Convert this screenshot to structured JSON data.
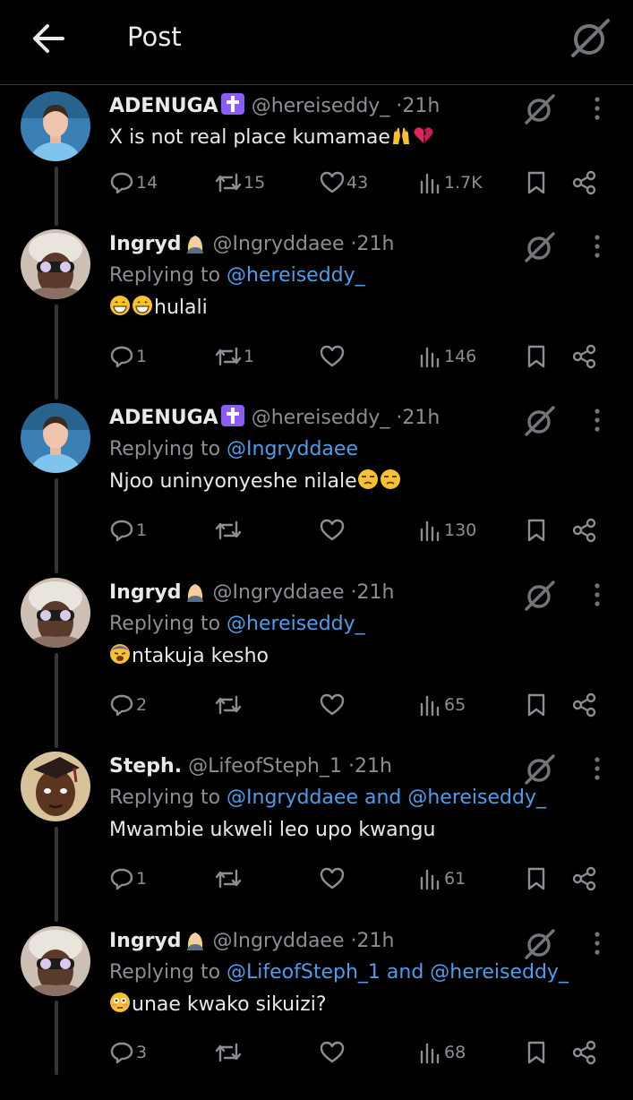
{
  "header": {
    "title": "Post"
  },
  "colors": {
    "background": "#000000",
    "text": "#e7e9ea",
    "muted": "#8b8f94",
    "link": "#4c9eeb"
  },
  "tweets": [
    {
      "name": "ADENUGA",
      "name_badge": "✝",
      "handle": "@hereiseddy_",
      "dot": "·",
      "time": "21h",
      "reply_prefix": "",
      "reply_to": "",
      "text": "X is not real place kumamae",
      "emojis": [
        "raising-hands",
        "broken-heart"
      ],
      "replies": "14",
      "reposts": "15",
      "likes": "43",
      "views": "1.7K"
    },
    {
      "name": "Ingryd",
      "name_badge": "👩‍💼",
      "handle": "@Ingryddaee",
      "dot": "·",
      "time": "21h",
      "reply_prefix": "Replying to",
      "reply_to": "@hereiseddy_",
      "text": "hulali",
      "emojis": [
        "grin",
        "grin"
      ],
      "replies": "1",
      "reposts": "1",
      "likes": "",
      "views": "146"
    },
    {
      "name": "ADENUGA",
      "name_badge": "✝",
      "handle": "@hereiseddy_",
      "dot": "·",
      "time": "21h",
      "reply_prefix": "Replying to",
      "reply_to": "@Ingryddaee",
      "text": "Njoo uninyonyeshe nilale",
      "emojis": [
        "unamused",
        "unamused"
      ],
      "replies": "1",
      "reposts": "",
      "likes": "",
      "views": "130"
    },
    {
      "name": "Ingryd",
      "name_badge": "👩‍💼",
      "handle": "@Ingryddaee",
      "dot": "·",
      "time": "21h",
      "reply_prefix": "Replying to",
      "reply_to": "@hereiseddy_",
      "text": "ntakuja kesho",
      "emojis": [
        "weary"
      ],
      "replies": "2",
      "reposts": "",
      "likes": "",
      "views": "65"
    },
    {
      "name": "Steph.",
      "name_badge": "",
      "handle": "@LifeofSteph_1",
      "dot": "·",
      "time": "21h",
      "reply_prefix": "Replying to",
      "reply_to": "@Ingryddaee and @hereiseddy_",
      "text": "Mwambie ukweli leo upo kwangu",
      "emojis": [],
      "replies": "1",
      "reposts": "",
      "likes": "",
      "views": "61"
    },
    {
      "name": "Ingryd",
      "name_badge": "👩‍💼",
      "handle": "@Ingryddaee",
      "dot": "·",
      "time": "21h",
      "reply_prefix": "Replying to",
      "reply_to": "@LifeofSteph_1 and @hereiseddy_",
      "text": "unae kwako sikuizi?",
      "emojis": [
        "flushed"
      ],
      "replies": "3",
      "reposts": "",
      "likes": "",
      "views": "68"
    }
  ]
}
